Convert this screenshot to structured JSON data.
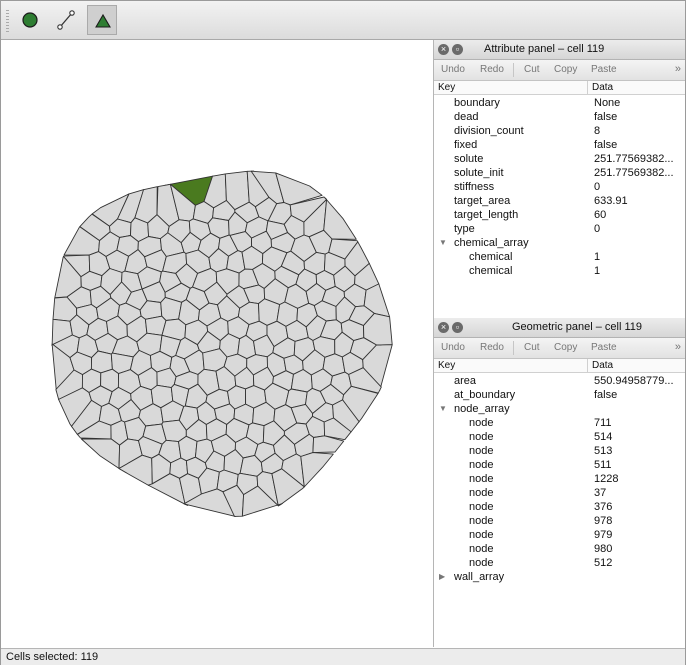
{
  "toolbar": {
    "tools": [
      {
        "name": "cell-tool",
        "icon": "filled-circle-icon",
        "color": "#2e7d32",
        "active": false
      },
      {
        "name": "wall-tool",
        "icon": "line-edge-icon",
        "active": false
      },
      {
        "name": "shape-tool",
        "icon": "triangle-icon",
        "color": "#2e7d32",
        "active": true
      }
    ]
  },
  "colors": {
    "cell_fill": "#d9d9d9",
    "cell_stroke": "#333333",
    "selected_cell": "#4a7a1f",
    "selection_halo": "#b0b0b0"
  },
  "attribute_panel": {
    "title": "Attribute panel   –  cell 119",
    "buttons": [
      "Undo",
      "Redo",
      "Cut",
      "Copy",
      "Paste"
    ],
    "more": "»",
    "columns": {
      "key": "Key",
      "data": "Data"
    },
    "rows": [
      {
        "key": "boundary",
        "value": "None"
      },
      {
        "key": "dead",
        "value": "false"
      },
      {
        "key": "division_count",
        "value": "8"
      },
      {
        "key": "fixed",
        "value": "false"
      },
      {
        "key": "solute",
        "value": "251.77569382..."
      },
      {
        "key": "solute_init",
        "value": "251.77569382..."
      },
      {
        "key": "stiffness",
        "value": "0"
      },
      {
        "key": "target_area",
        "value": "633.91"
      },
      {
        "key": "target_length",
        "value": "60"
      },
      {
        "key": "type",
        "value": "0"
      },
      {
        "key": "chemical_array",
        "value": "",
        "expander": "expanded"
      },
      {
        "key": "chemical",
        "value": "1",
        "child": true
      },
      {
        "key": "chemical",
        "value": "1",
        "child": true
      }
    ]
  },
  "geometric_panel": {
    "title": "Geometric panel   –  cell 119",
    "buttons": [
      "Undo",
      "Redo",
      "Cut",
      "Copy",
      "Paste"
    ],
    "more": "»",
    "columns": {
      "key": "Key",
      "data": "Data"
    },
    "rows": [
      {
        "key": "area",
        "value": "550.94958779..."
      },
      {
        "key": "at_boundary",
        "value": "false"
      },
      {
        "key": "node_array",
        "value": "",
        "expander": "expanded"
      },
      {
        "key": "node",
        "value": "711",
        "child": true
      },
      {
        "key": "node",
        "value": "514",
        "child": true
      },
      {
        "key": "node",
        "value": "513",
        "child": true
      },
      {
        "key": "node",
        "value": "511",
        "child": true
      },
      {
        "key": "node",
        "value": "1228",
        "child": true
      },
      {
        "key": "node",
        "value": "37",
        "child": true
      },
      {
        "key": "node",
        "value": "376",
        "child": true
      },
      {
        "key": "node",
        "value": "978",
        "child": true
      },
      {
        "key": "node",
        "value": "979",
        "child": true
      },
      {
        "key": "node",
        "value": "980",
        "child": true
      },
      {
        "key": "node",
        "value": "512",
        "child": true
      },
      {
        "key": "wall_array",
        "value": "",
        "expander": "collapsed"
      }
    ]
  },
  "status": {
    "text": "Cells selected: 119"
  }
}
